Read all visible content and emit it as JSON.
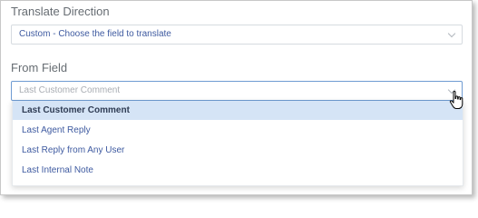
{
  "translate_direction": {
    "label": "Translate Direction",
    "selected": "Custom - Choose the field to translate",
    "icon": "chevron-down-icon"
  },
  "from_field": {
    "label": "From Field",
    "placeholder": "Last Customer Comment",
    "icon": "chevron-down-icon",
    "dropdown_open": true,
    "options": [
      {
        "label": "Last Customer Comment",
        "highlighted": true
      },
      {
        "label": "Last Agent Reply",
        "highlighted": false
      },
      {
        "label": "Last Reply from Any User",
        "highlighted": false
      },
      {
        "label": "Last Internal Note",
        "highlighted": false
      }
    ]
  },
  "cursor": "pointer-hand-icon",
  "colors": {
    "label_text": "#666c72",
    "value_text": "#3e5aa0",
    "focus_border": "#6f9bd2",
    "highlight_bg": "#d5e4f6"
  }
}
